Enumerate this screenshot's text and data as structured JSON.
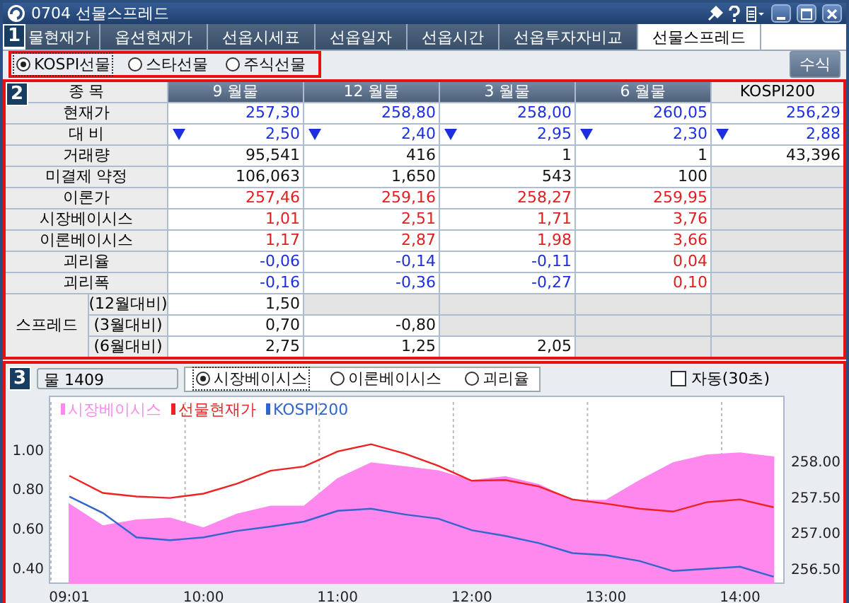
{
  "window": {
    "title": "0704 선물스프레드"
  },
  "tabs_badge": "1",
  "tabs": [
    {
      "label": "물현재가",
      "selected": false
    },
    {
      "label": "옵션현재가",
      "selected": false
    },
    {
      "label": "선옵시세표",
      "selected": false
    },
    {
      "label": "선옵일자",
      "selected": false
    },
    {
      "label": "선옵시간",
      "selected": false
    },
    {
      "label": "선옵투자자비교",
      "selected": false
    },
    {
      "label": "선물스프레드",
      "selected": true
    }
  ],
  "market_options": [
    {
      "label": "KOSPI선물",
      "selected": true
    },
    {
      "label": "스타선물",
      "selected": false
    },
    {
      "label": "주식선물",
      "selected": false
    }
  ],
  "formula_button": "수식",
  "table": {
    "badge": "2",
    "corner": "종 목",
    "columns": [
      {
        "label": "9 월물",
        "kind": "month"
      },
      {
        "label": "12 월물",
        "kind": "month"
      },
      {
        "label": "3 월물",
        "kind": "month"
      },
      {
        "label": "6 월물",
        "kind": "month"
      },
      {
        "label": "KOSPI200",
        "kind": "index"
      }
    ],
    "rows": [
      {
        "label": "현재가",
        "cells": [
          {
            "kind": "value",
            "text": "257,30",
            "color": "#1c2fe0"
          },
          {
            "kind": "value",
            "text": "258,80",
            "color": "#1c2fe0"
          },
          {
            "kind": "value",
            "text": "258,00",
            "color": "#1c2fe0"
          },
          {
            "kind": "value",
            "text": "260,05",
            "color": "#1c2fe0"
          },
          {
            "kind": "value",
            "text": "256,29",
            "color": "#1c2fe0"
          }
        ]
      },
      {
        "label": "대 비",
        "cells": [
          {
            "kind": "value",
            "text": "2,50",
            "color": "#1c2fe0",
            "down_arrow": true
          },
          {
            "kind": "value",
            "text": "2,40",
            "color": "#1c2fe0",
            "down_arrow": true
          },
          {
            "kind": "value",
            "text": "2,95",
            "color": "#1c2fe0",
            "down_arrow": true
          },
          {
            "kind": "value",
            "text": "2,30",
            "color": "#1c2fe0",
            "down_arrow": true
          },
          {
            "kind": "value",
            "text": "2,88",
            "color": "#1c2fe0",
            "down_arrow": true
          }
        ]
      },
      {
        "label": "거래량",
        "cells": [
          {
            "kind": "value",
            "text": "95,541",
            "color": "#111111"
          },
          {
            "kind": "value",
            "text": "416",
            "color": "#111111"
          },
          {
            "kind": "value",
            "text": "1",
            "color": "#111111"
          },
          {
            "kind": "value",
            "text": "1",
            "color": "#111111"
          },
          {
            "kind": "value",
            "text": "43,396",
            "color": "#111111"
          }
        ]
      },
      {
        "label": "미결제 약정",
        "cells": [
          {
            "kind": "value",
            "text": "106,063",
            "color": "#111111"
          },
          {
            "kind": "value",
            "text": "1,650",
            "color": "#111111"
          },
          {
            "kind": "value",
            "text": "543",
            "color": "#111111"
          },
          {
            "kind": "value",
            "text": "100",
            "color": "#111111"
          },
          {
            "kind": "blank"
          }
        ]
      },
      {
        "label": "이론가",
        "cells": [
          {
            "kind": "value",
            "text": "257,46",
            "color": "#e02020"
          },
          {
            "kind": "value",
            "text": "259,16",
            "color": "#e02020"
          },
          {
            "kind": "value",
            "text": "258,27",
            "color": "#e02020"
          },
          {
            "kind": "value",
            "text": "259,95",
            "color": "#e02020"
          },
          {
            "kind": "blank"
          }
        ]
      },
      {
        "label": "시장베이시스",
        "cells": [
          {
            "kind": "value",
            "text": "1,01",
            "color": "#e02020"
          },
          {
            "kind": "value",
            "text": "2,51",
            "color": "#e02020"
          },
          {
            "kind": "value",
            "text": "1,71",
            "color": "#e02020"
          },
          {
            "kind": "value",
            "text": "3,76",
            "color": "#e02020"
          },
          {
            "kind": "blank"
          }
        ]
      },
      {
        "label": "이론베이시스",
        "cells": [
          {
            "kind": "value",
            "text": "1,17",
            "color": "#e02020"
          },
          {
            "kind": "value",
            "text": "2,87",
            "color": "#e02020"
          },
          {
            "kind": "value",
            "text": "1,98",
            "color": "#e02020"
          },
          {
            "kind": "value",
            "text": "3,66",
            "color": "#e02020"
          },
          {
            "kind": "blank"
          }
        ]
      },
      {
        "label": "괴리율",
        "cells": [
          {
            "kind": "value",
            "text": "-0,06",
            "color": "#1c2fe0"
          },
          {
            "kind": "value",
            "text": "-0,14",
            "color": "#1c2fe0"
          },
          {
            "kind": "value",
            "text": "-0,11",
            "color": "#1c2fe0"
          },
          {
            "kind": "value",
            "text": "0,04",
            "color": "#e02020"
          },
          {
            "kind": "blank"
          }
        ]
      },
      {
        "label": "괴리폭",
        "cells": [
          {
            "kind": "value",
            "text": "-0,16",
            "color": "#1c2fe0"
          },
          {
            "kind": "value",
            "text": "-0,36",
            "color": "#1c2fe0"
          },
          {
            "kind": "value",
            "text": "-0,27",
            "color": "#1c2fe0"
          },
          {
            "kind": "value",
            "text": "0,10",
            "color": "#e02020"
          },
          {
            "kind": "blank"
          }
        ]
      }
    ],
    "spread": {
      "label": "스프레드",
      "rows": [
        {
          "label": "(12월대비)",
          "cells": [
            {
              "kind": "value",
              "text": "1,50",
              "color": "#111111"
            },
            {
              "kind": "blank"
            },
            {
              "kind": "blank"
            },
            {
              "kind": "blank"
            },
            {
              "kind": "blank"
            }
          ]
        },
        {
          "label": "(3월대비)",
          "cells": [
            {
              "kind": "value",
              "text": "0,70",
              "color": "#111111"
            },
            {
              "kind": "value",
              "text": "-0,80",
              "color": "#111111"
            },
            {
              "kind": "blank"
            },
            {
              "kind": "blank"
            },
            {
              "kind": "blank"
            }
          ]
        },
        {
          "label": "(6월대비)",
          "cells": [
            {
              "kind": "value",
              "text": "2,75",
              "color": "#111111"
            },
            {
              "kind": "value",
              "text": "1,25",
              "color": "#111111"
            },
            {
              "kind": "value",
              "text": "2,05",
              "color": "#111111"
            },
            {
              "kind": "blank"
            },
            {
              "kind": "blank"
            }
          ]
        }
      ]
    }
  },
  "chart_panel": {
    "badge": "3",
    "contract": "물 1409",
    "modes": [
      {
        "label": "시장베이시스",
        "selected": true
      },
      {
        "label": "이론베이시스",
        "selected": false
      },
      {
        "label": "괴리율",
        "selected": false
      }
    ],
    "auto_refresh": {
      "label": "자동(30초)",
      "checked": false
    },
    "chart_data": {
      "type": "line",
      "categories": [
        "09:01",
        null,
        null,
        null,
        "10:00",
        null,
        null,
        null,
        "11:00",
        null,
        null,
        null,
        "12:00",
        null,
        null,
        null,
        "13:00",
        null,
        null,
        null,
        "14:00",
        null
      ],
      "legend": "upper left",
      "ylim": [
        0.32,
        1.24
      ],
      "yticks": [
        {
          "value": 1.0,
          "label": "1.00"
        },
        {
          "value": 0.8,
          "label": "0.80"
        },
        {
          "value": 0.6,
          "label": "0.60"
        },
        {
          "value": 0.4,
          "label": "0.40"
        }
      ],
      "y2lim": [
        256.29,
        258.82
      ],
      "y2ticks": [
        {
          "value": 258.0,
          "label": "258.00"
        },
        {
          "value": 257.5,
          "label": "257.50"
        },
        {
          "value": 257.0,
          "label": "257.00"
        },
        {
          "value": 256.5,
          "label": "256.50"
        }
      ],
      "series": [
        {
          "name": "시장베이시스",
          "color": "#ff88ee",
          "type": "area",
          "values": [
            0.72,
            0.61,
            0.64,
            0.65,
            0.6,
            0.67,
            0.71,
            0.71,
            0.85,
            0.93,
            0.91,
            0.89,
            0.84,
            0.86,
            0.82,
            0.74,
            0.74,
            0.84,
            0.93,
            0.97,
            0.98,
            0.96
          ]
        },
        {
          "name": "선물현재가",
          "color": "#ee2222",
          "type": "line",
          "axis": "y2",
          "values": [
            257.79,
            257.55,
            257.5,
            257.48,
            257.54,
            257.68,
            257.86,
            257.92,
            258.13,
            258.23,
            258.1,
            257.93,
            257.72,
            257.73,
            257.64,
            257.46,
            257.4,
            257.33,
            257.29,
            257.42,
            257.46,
            257.35
          ]
        },
        {
          "name": "KOSPI200",
          "color": "#3366cc",
          "type": "line",
          "axis": "y2",
          "values": [
            257.5,
            257.27,
            256.93,
            256.89,
            256.93,
            257.02,
            257.08,
            257.15,
            257.3,
            257.33,
            257.25,
            257.19,
            257.03,
            256.95,
            256.85,
            256.71,
            256.68,
            256.6,
            256.46,
            256.49,
            256.52,
            256.38
          ]
        }
      ]
    }
  }
}
